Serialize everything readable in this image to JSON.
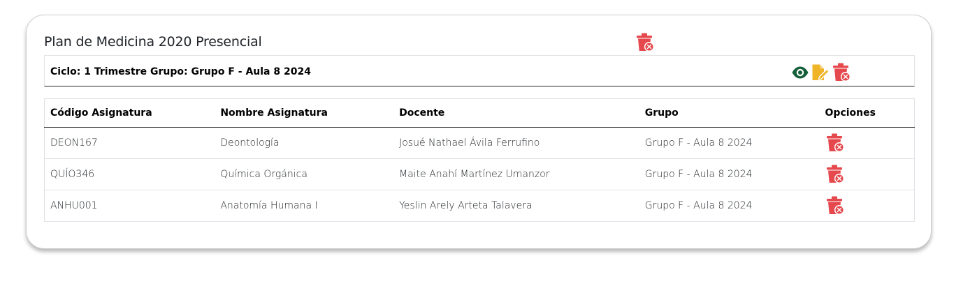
{
  "plan": {
    "title": "Plan de Medicina 2020 Presencial",
    "delete_icon": "trash-delete-icon"
  },
  "cycle": {
    "title": "Ciclo: 1 Trimestre Grupo: Grupo F - Aula 8 2024",
    "actions": [
      "eye-icon",
      "file-edit-icon",
      "trash-delete-icon"
    ]
  },
  "table": {
    "headers": [
      "Código Asignatura",
      "Nombre Asignatura",
      "Docente",
      "Grupo",
      "Opciones"
    ],
    "rows": [
      {
        "code": "DEON167",
        "name": "Deontología",
        "teacher": "Josué Nathael Ávila Ferrufino",
        "group": "Grupo F - Aula 8 2024"
      },
      {
        "code": "QUÍO346",
        "name": "Química Orgánica",
        "teacher": "Maite Anahí Martínez Umanzor",
        "group": "Grupo F - Aula 8 2024"
      },
      {
        "code": "ANHU001",
        "name": "Anatomía Humana I",
        "teacher": "Yeslin Arely Arteta Talavera",
        "group": "Grupo F - Aula 8 2024"
      }
    ]
  },
  "colors": {
    "delete": "#e5484d",
    "view": "#15603b",
    "edit": "#f0b429"
  }
}
